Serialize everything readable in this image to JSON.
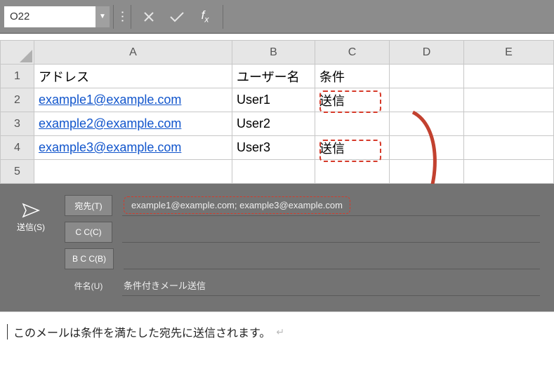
{
  "formula_bar": {
    "name_box_value": "O22",
    "cancel_glyph": "✕",
    "accept_glyph": "✓",
    "fx_label_f": "f",
    "fx_label_x": "x",
    "formula_value": ""
  },
  "columns": [
    "A",
    "B",
    "C",
    "D",
    "E"
  ],
  "rows": [
    {
      "num": "1",
      "a": "アドレス",
      "b": "ユーザー名",
      "c": "条件",
      "is_header": true
    },
    {
      "num": "2",
      "a": "example1@example.com",
      "b": "User1",
      "c": "送信"
    },
    {
      "num": "3",
      "a": "example2@example.com",
      "b": "User2",
      "c": ""
    },
    {
      "num": "4",
      "a": "example3@example.com",
      "b": "User3",
      "c": "送信"
    },
    {
      "num": "5",
      "a": "",
      "b": "",
      "c": ""
    }
  ],
  "mail": {
    "send_label": "送信(S)",
    "to_button": "宛先(T)",
    "cc_button": "C C(C)",
    "bcc_button": "B C C(B)",
    "subject_label": "件名(U)",
    "to_value": "example1@example.com; example3@example.com",
    "cc_value": "",
    "bcc_value": "",
    "subject_value": "条件付きメール送信"
  },
  "body_text": "このメールは条件を満たした宛先に送信されます。",
  "annotations": {
    "highlight_fill": "送信",
    "arrow_color": "#c2412f"
  }
}
